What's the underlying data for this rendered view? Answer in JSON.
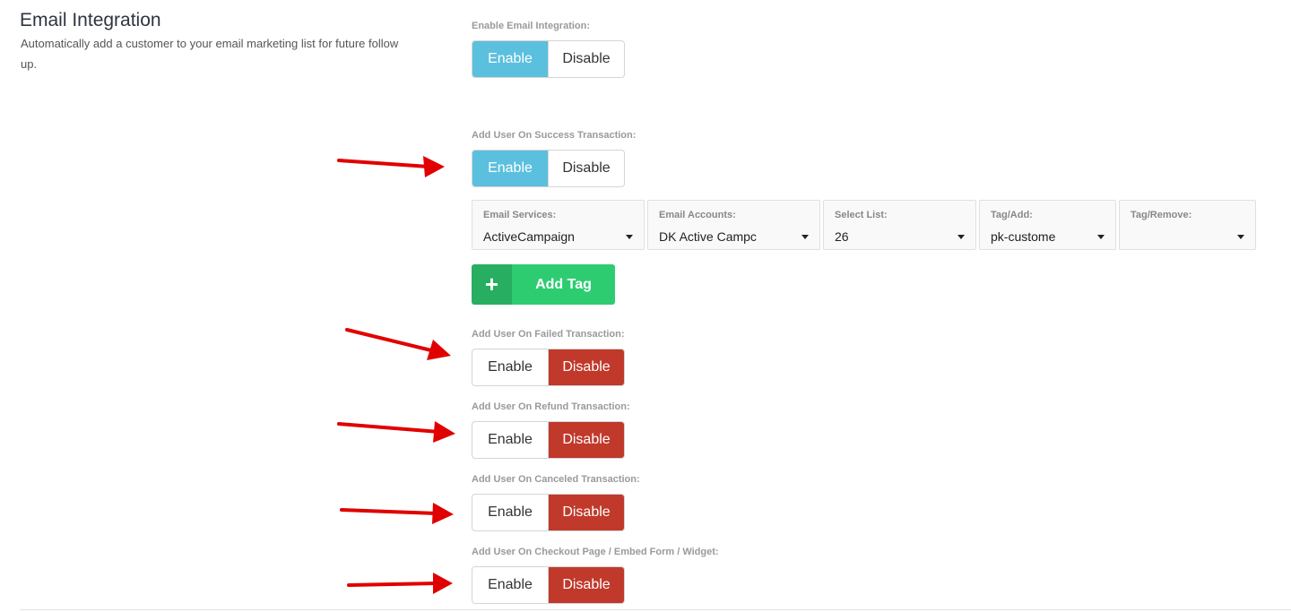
{
  "header": {
    "title": "Email Integration",
    "description": "Automatically add a customer to your email marketing list for future follow up."
  },
  "toggles": [
    {
      "label": "Enable Email Integration:",
      "enable": "Enable",
      "disable": "Disable",
      "selected": "enable"
    },
    {
      "label": "Add User On Success Transaction:",
      "enable": "Enable",
      "disable": "Disable",
      "selected": "enable"
    },
    {
      "label": "Add User On Failed Transaction:",
      "enable": "Enable",
      "disable": "Disable",
      "selected": "disable"
    },
    {
      "label": "Add User On Refund Transaction:",
      "enable": "Enable",
      "disable": "Disable",
      "selected": "disable"
    },
    {
      "label": "Add User On Canceled Transaction:",
      "enable": "Enable",
      "disable": "Disable",
      "selected": "disable"
    },
    {
      "label": "Add User On Checkout Page / Embed Form / Widget:",
      "enable": "Enable",
      "disable": "Disable",
      "selected": "disable"
    }
  ],
  "dropdowns": [
    {
      "label": "Email Services:",
      "value": "ActiveCampaign"
    },
    {
      "label": "Email Accounts:",
      "value": "DK Active Campc"
    },
    {
      "label": "Select List:",
      "value": "26"
    },
    {
      "label": "Tag/Add:",
      "value": "pk-custome"
    },
    {
      "label": "Tag/Remove:",
      "value": ""
    }
  ],
  "add_tag": {
    "icon": "+",
    "label": "Add Tag"
  },
  "colors": {
    "enable_selected": "#5bc0de",
    "disable_selected": "#c0392b",
    "add_tag": "#2ecc71",
    "arrow": "#e00000"
  }
}
